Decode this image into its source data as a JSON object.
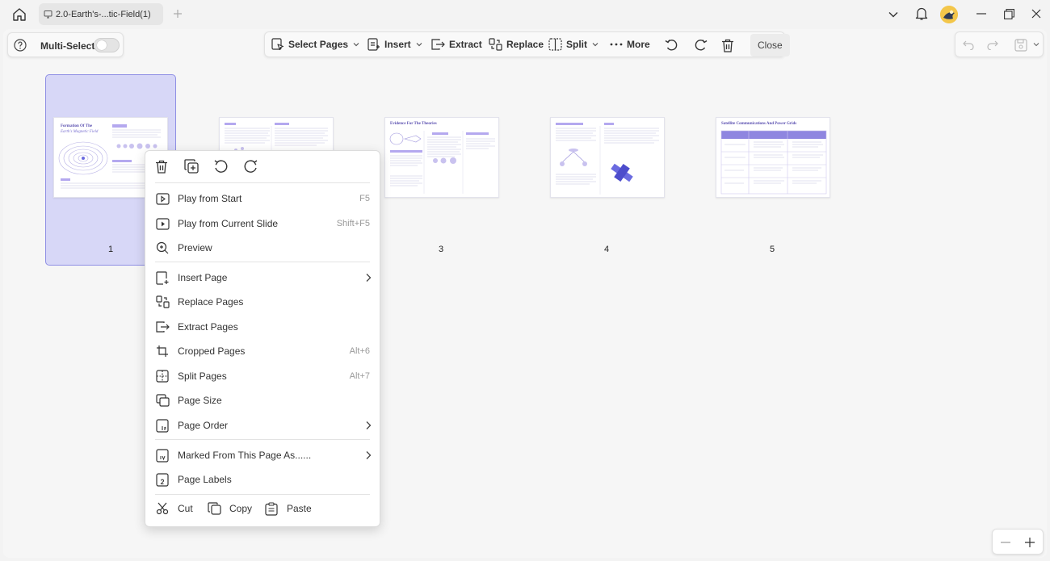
{
  "titlebar": {
    "tab_title": "2.0-Earth's-...tic-Field(1)"
  },
  "left_toolbar": {
    "multi_select_label": "Multi-Select"
  },
  "toolbar": {
    "select_pages": "Select Pages",
    "insert": "Insert",
    "extract": "Extract",
    "replace": "Replace",
    "split": "Split",
    "more": "More",
    "close": "Close"
  },
  "pages": [
    {
      "number": "1",
      "title": "Formation Of The",
      "subtitle": "Earth's Magnetic Field",
      "selected": true
    },
    {
      "number": "2",
      "title": "",
      "subtitle": "",
      "selected": false
    },
    {
      "number": "3",
      "title": "Evidence For The Theories",
      "subtitle": "",
      "selected": false
    },
    {
      "number": "4",
      "title": "",
      "subtitle": "",
      "selected": false
    },
    {
      "number": "5",
      "title": "Satellite Communications And Power Grids",
      "subtitle": "",
      "selected": false
    }
  ],
  "context_menu": {
    "items": [
      {
        "label": "Play from Start",
        "shortcut": "F5"
      },
      {
        "label": "Play from Current Slide",
        "shortcut": "Shift+F5"
      },
      {
        "label": "Preview",
        "shortcut": ""
      },
      {
        "label": "Insert Page",
        "shortcut": ""
      },
      {
        "label": "Replace Pages",
        "shortcut": ""
      },
      {
        "label": "Extract Pages",
        "shortcut": ""
      },
      {
        "label": "Cropped Pages",
        "shortcut": "Alt+6"
      },
      {
        "label": "Split Pages",
        "shortcut": "Alt+7"
      },
      {
        "label": "Page Size",
        "shortcut": ""
      },
      {
        "label": "Page Order",
        "shortcut": ""
      },
      {
        "label": "Marked From This Page As......",
        "shortcut": ""
      },
      {
        "label": "Page Labels",
        "shortcut": ""
      }
    ],
    "cut": "Cut",
    "copy": "Copy",
    "paste": "Paste"
  },
  "colors": {
    "accent": "#6b6be0",
    "selection_bg": "#d7d7f7",
    "selection_border": "#8f8fe4"
  }
}
